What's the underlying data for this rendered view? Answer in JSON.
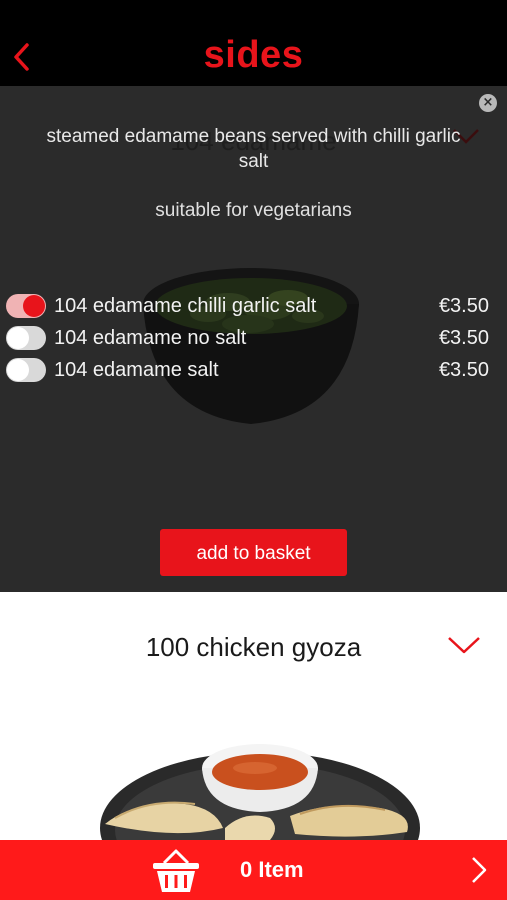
{
  "header": {
    "title": "sides",
    "back_icon": "chevron-left-icon"
  },
  "expanded_item": {
    "title": "104 edamame",
    "description": "steamed edamame beans served with chilli garlic salt",
    "dietary_note": "suitable for vegetarians",
    "options": [
      {
        "label": "104 edamame chilli garlic salt",
        "price": "€3.50",
        "selected": true
      },
      {
        "label": "104 edamame no salt",
        "price": "€3.50",
        "selected": false
      },
      {
        "label": "104 edamame salt",
        "price": "€3.50",
        "selected": false
      }
    ],
    "add_button_label": "add to basket"
  },
  "next_item": {
    "title": "100 chicken gyoza",
    "chevron_icon": "chevron-down-icon"
  },
  "footer": {
    "basket_icon": "basket-icon",
    "items_label": "0 Item",
    "chevron_icon": "chevron-right-icon"
  },
  "colors": {
    "accent": "#e8141b",
    "footer": "#ff1a1a",
    "panel": "#2b2b2b",
    "header": "#000000"
  }
}
